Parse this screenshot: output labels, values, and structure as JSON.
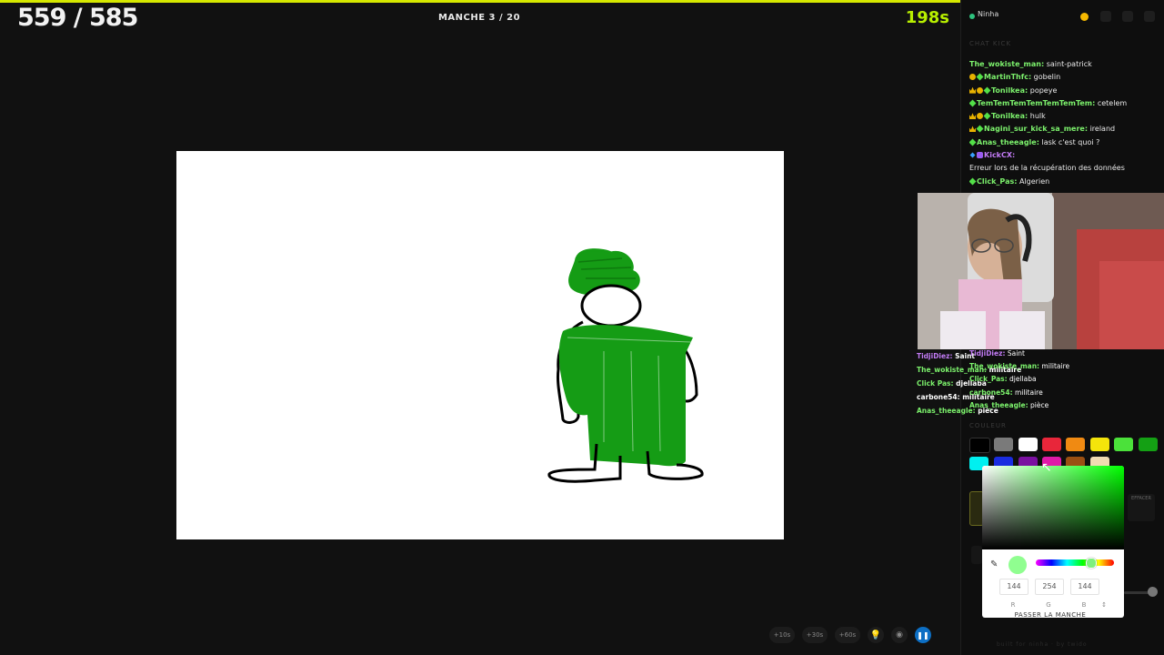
{
  "game": {
    "score": "559 / 585",
    "round": "MANCHE 3 / 20",
    "timer": "198s"
  },
  "toolbar": {
    "add10": "+10s",
    "add30": "+30s",
    "add60": "+60s"
  },
  "panel": {
    "username": "Ninha",
    "chat_title": "CHAT KICK",
    "messages": [
      {
        "user": "The_wokiste_man:",
        "text": " saint-patrick"
      },
      {
        "user": "MartinThfc:",
        "text": " gobelin"
      },
      {
        "user": "Tonilkea:",
        "text": " popeye"
      },
      {
        "user": "TemTemTemTemTemTemTem:",
        "text": " cetelem"
      },
      {
        "user": "Tonilkea:",
        "text": " hulk"
      },
      {
        "user": "Nagini_sur_kick_sa_mere:",
        "text": " ireland"
      },
      {
        "user": "Anas_theeagle:",
        "text": " lask c'est quoi ?"
      },
      {
        "user": "KickCX:",
        "text": ""
      },
      {
        "user": "",
        "text": "Erreur lors de la récupération des données"
      },
      {
        "user": "Click_Pas:",
        "text": " Algerien"
      }
    ],
    "overlay_messages": [
      {
        "user": "TidjiDiez:",
        "text": " Saint"
      },
      {
        "user": "The_wokiste_man:",
        "text": " militaire"
      },
      {
        "user": "Click_Pas:",
        "text": " djellaba"
      },
      {
        "user": "carbone54:",
        "text": " militaire"
      },
      {
        "user": "Anas_theeagle:",
        "text": " pièce"
      }
    ],
    "stream_overlay": [
      {
        "user": "TidjiDiez:",
        "text": " Saint"
      },
      {
        "user": "The_wokiste_man:",
        "text": " militaire"
      },
      {
        "user": "Click Pas:",
        "text": " djellaba"
      },
      {
        "user": "carbone54:",
        "text": " militaire"
      },
      {
        "user": "Anas_theeagle:",
        "text": " pièce"
      }
    ],
    "couleur_label": "COULEUR",
    "effacer": "EFFACER",
    "passer": "PASSER LA MANCHE",
    "footer": "built for ninha · by twido"
  },
  "palette": [
    "#000000",
    "#7a7a7a",
    "#ffffff",
    "#e8263a",
    "#f08a12",
    "#f4e40b",
    "#4be13a",
    "#14a014",
    "#00f0f0",
    "#1a2ce0",
    "#7a10a0",
    "#e01aa8",
    "#9a4f12",
    "#f2dcb2"
  ],
  "picker": {
    "r": "144",
    "g": "254",
    "b": "144",
    "r_label": "R",
    "g_label": "G",
    "b_label": "B",
    "selected_color": "#90fe90"
  }
}
